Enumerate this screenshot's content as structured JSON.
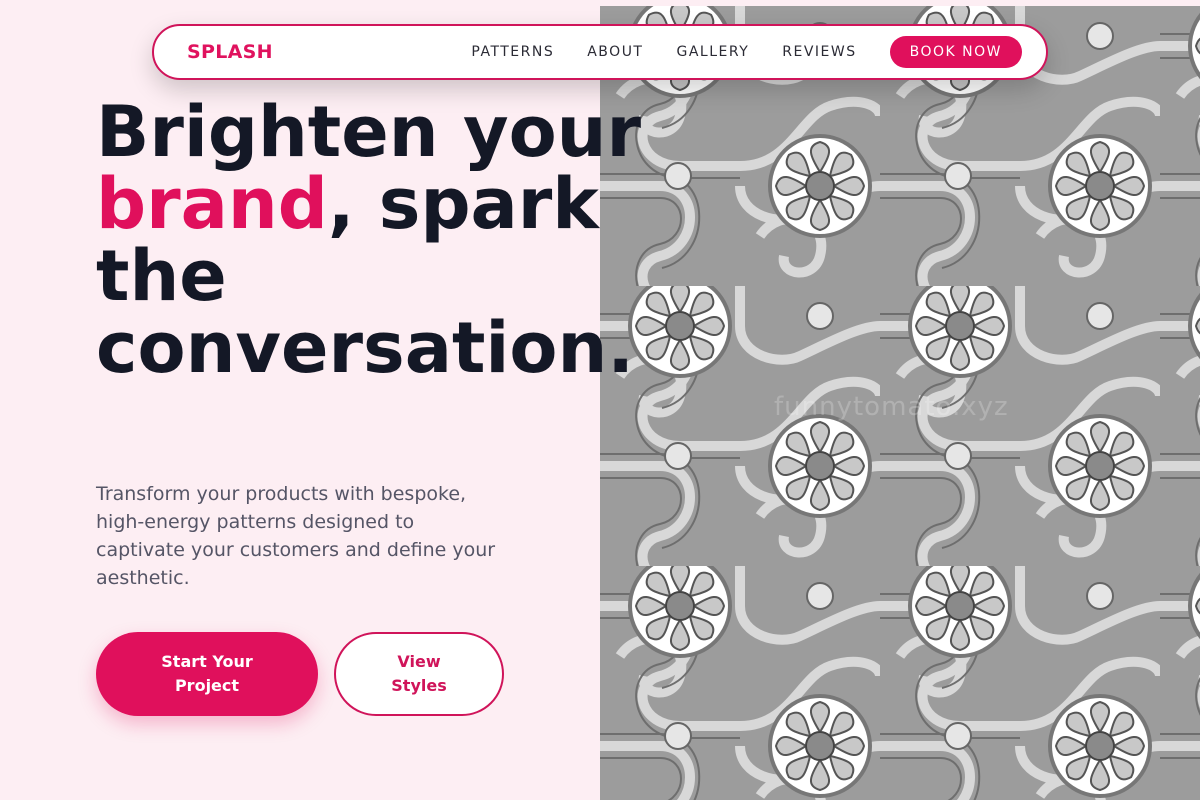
{
  "brand": {
    "name": "SPLASH",
    "accent_color": "#e0105c"
  },
  "nav": {
    "links": [
      "PATTERNS",
      "ABOUT",
      "GALLERY",
      "REVIEWS"
    ],
    "cta": "BOOK NOW"
  },
  "hero": {
    "title_line1": "Brighten your",
    "title_accent": "brand",
    "title_rest": ", spark the conversation.",
    "subtitle": "Transform your products with bespoke, high-energy patterns designed to captivate your customers and define your aesthetic.",
    "primary_button": "Start Your Project",
    "secondary_button": "View Styles"
  },
  "image": {
    "description_icon": "swirl-flower-pattern-image",
    "watermark": "funnytomato.xyz"
  }
}
